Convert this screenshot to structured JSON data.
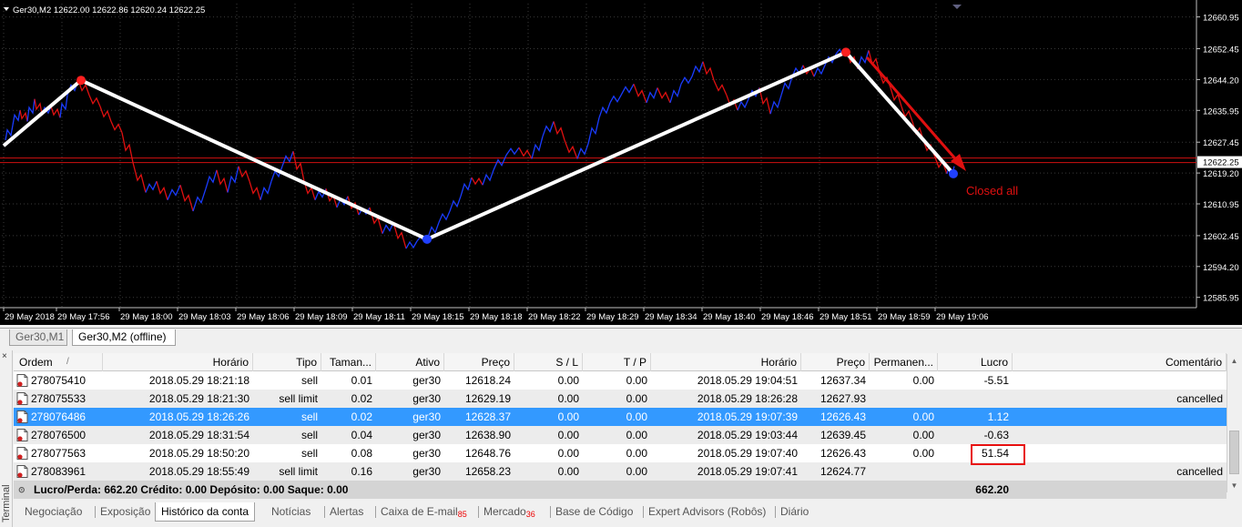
{
  "chart": {
    "symbol_info": "Ger30,M2  12622.00 12622.86 12620.24 12622.25",
    "price_levels": [
      "12660.95",
      "12652.45",
      "12644.20",
      "12635.95",
      "12627.45",
      "12619.20",
      "12610.95",
      "12602.45",
      "12594.20",
      "12585.95"
    ],
    "current_price": "12622.25",
    "time_labels": [
      "29 May 2018",
      "29 May 17:56",
      "29 May 18:00",
      "29 May 18:03",
      "29 May 18:06",
      "29 May 18:09",
      "29 May 18:11",
      "29 May 18:15",
      "29 May 18:18",
      "29 May 18:22",
      "29 May 18:29",
      "29 May 18:34",
      "29 May 18:40",
      "29 May 18:46",
      "29 May 18:51",
      "29 May 18:59",
      "29 May 19:06"
    ],
    "annotation": "Closed all",
    "colors": {
      "up": "#1a3cff",
      "down": "#e01010",
      "zigzag": "#ffffff",
      "marker_top": "#ff2020",
      "marker_bottom": "#2040ff",
      "line": "#d01010"
    }
  },
  "chart_tabs": [
    "Ger30,M1",
    "Ger30,M2 (offline)"
  ],
  "table": {
    "headers": [
      "Ordem",
      "Horário",
      "Tipo",
      "Taman...",
      "Ativo",
      "Preço",
      "S / L",
      "T / P",
      "Horário",
      "Preço",
      "Permanen...",
      "Lucro",
      "Comentário"
    ],
    "sort_indicator": "/",
    "rows": [
      [
        "278075410",
        "2018.05.29 18:21:18",
        "sell",
        "0.01",
        "ger30",
        "12618.24",
        "0.00",
        "0.00",
        "2018.05.29 19:04:51",
        "12637.34",
        "0.00",
        "-5.51",
        ""
      ],
      [
        "278075533",
        "2018.05.29 18:21:30",
        "sell limit",
        "0.02",
        "ger30",
        "12629.19",
        "0.00",
        "0.00",
        "2018.05.29 18:26:28",
        "12627.93",
        "",
        "",
        "cancelled"
      ],
      [
        "278076486",
        "2018.05.29 18:26:26",
        "sell",
        "0.02",
        "ger30",
        "12628.37",
        "0.00",
        "0.00",
        "2018.05.29 19:07:39",
        "12626.43",
        "0.00",
        "1.12",
        ""
      ],
      [
        "278076500",
        "2018.05.29 18:31:54",
        "sell",
        "0.04",
        "ger30",
        "12638.90",
        "0.00",
        "0.00",
        "2018.05.29 19:03:44",
        "12639.45",
        "0.00",
        "-0.63",
        ""
      ],
      [
        "278077563",
        "2018.05.29 18:50:20",
        "sell",
        "0.08",
        "ger30",
        "12648.76",
        "0.00",
        "0.00",
        "2018.05.29 19:07:40",
        "12626.43",
        "0.00",
        "51.54",
        ""
      ],
      [
        "278083961",
        "2018.05.29 18:55:49",
        "sell limit",
        "0.16",
        "ger30",
        "12658.23",
        "0.00",
        "0.00",
        "2018.05.29 19:07:41",
        "12624.77",
        "",
        "",
        "cancelled"
      ]
    ],
    "total_label": "Lucro/Perda: 662.20  Crédito: 0.00  Depósito: 0.00  Saque: 0.00",
    "total_value": "662.20"
  },
  "bottom_tabs": [
    {
      "label": "Negociação"
    },
    {
      "label": "Exposição"
    },
    {
      "label": "Histórico da conta"
    },
    {
      "label": "Notícias"
    },
    {
      "label": "Alertas"
    },
    {
      "label": "Caixa de E-mail",
      "badge": "85"
    },
    {
      "label": "Mercado",
      "badge": "36"
    },
    {
      "label": "Base de Código"
    },
    {
      "label": "Expert Advisors (Robôs)"
    },
    {
      "label": "Diário"
    }
  ],
  "terminal_label": "Terminal"
}
